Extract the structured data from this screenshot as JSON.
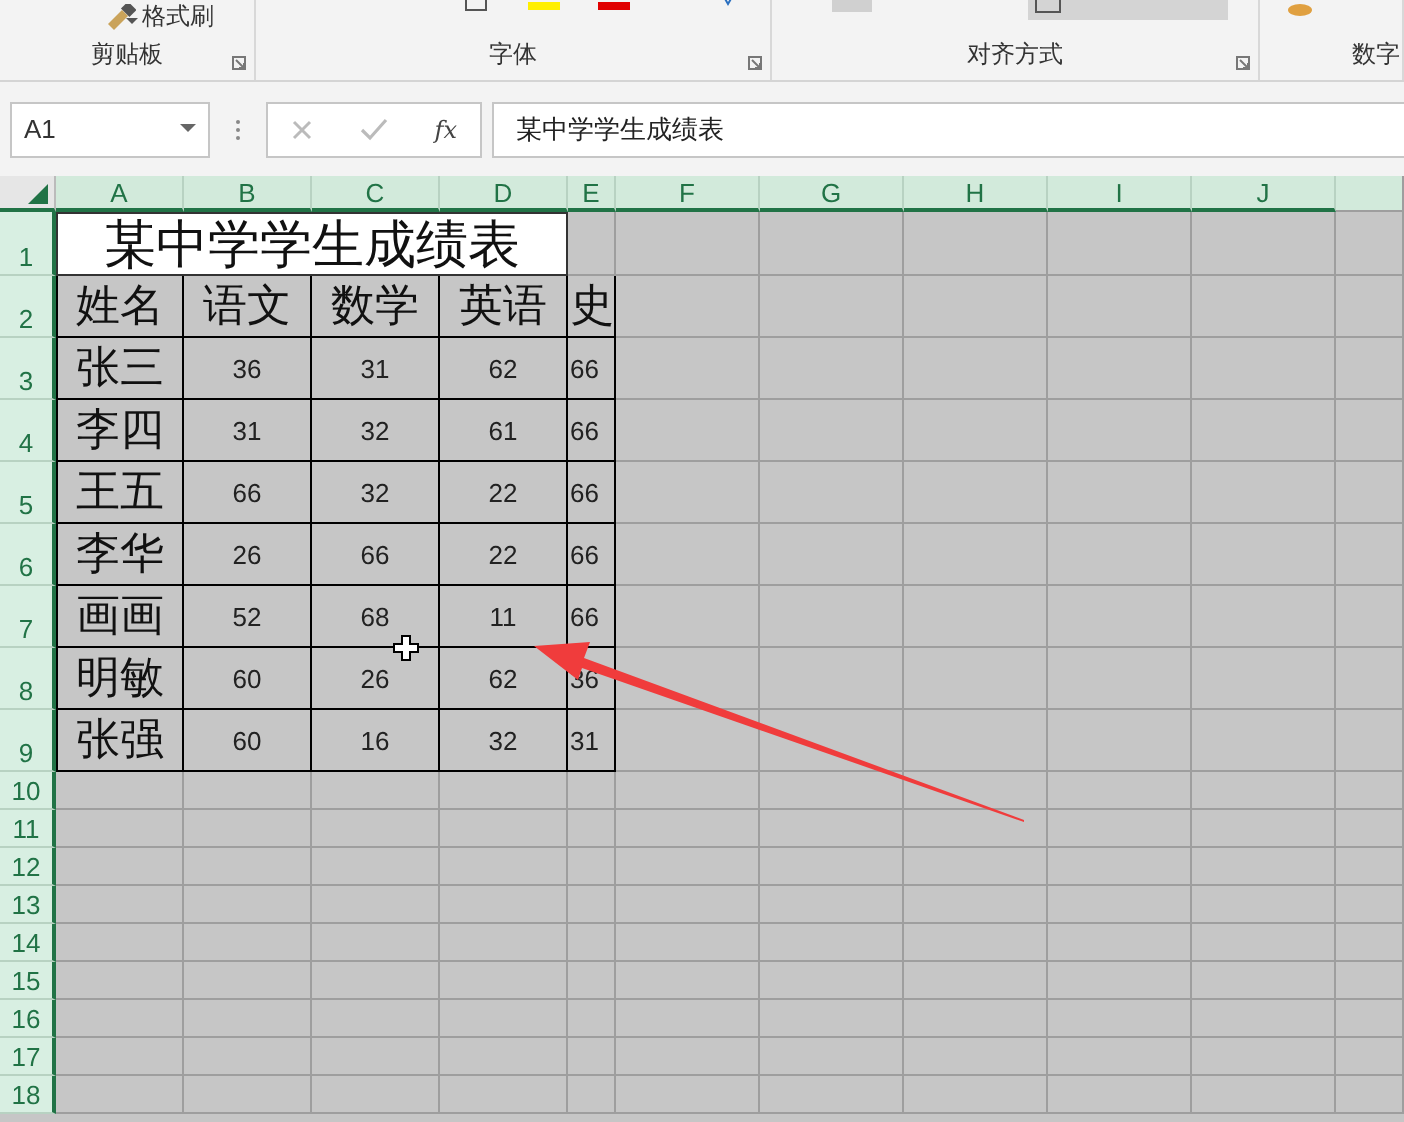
{
  "ribbon": {
    "format_painter": "格式刷",
    "groups": [
      {
        "label": "剪贴板"
      },
      {
        "label": "字体"
      },
      {
        "label": "对齐方式"
      },
      {
        "label": "数字"
      }
    ]
  },
  "formula_bar": {
    "name_box": "A1",
    "function_symbol": "fx",
    "content": "某中学学生成绩表"
  },
  "sheet": {
    "all_selected": true,
    "columns": [
      "A",
      "B",
      "C",
      "D",
      "E",
      "F",
      "G",
      "H",
      "I",
      "J"
    ],
    "rows": [
      "1",
      "2",
      "3",
      "4",
      "5",
      "6",
      "7",
      "8",
      "9",
      "10",
      "11",
      "12",
      "13",
      "14",
      "15",
      "16",
      "17",
      "18"
    ],
    "title": "某中学学生成绩表",
    "header": [
      "姓名",
      "语文",
      "数学",
      "英语",
      "史"
    ],
    "data": [
      [
        "张三",
        "36",
        "31",
        "62",
        "66"
      ],
      [
        "李四",
        "31",
        "32",
        "61",
        "66"
      ],
      [
        "王五",
        "66",
        "32",
        "22",
        "66"
      ],
      [
        "李华",
        "26",
        "66",
        "22",
        "66"
      ],
      [
        "画画",
        "52",
        "68",
        "11",
        "66"
      ],
      [
        "明敏",
        "60",
        "26",
        "62",
        "36"
      ],
      [
        "张强",
        "60",
        "16",
        "32",
        "31"
      ]
    ]
  }
}
